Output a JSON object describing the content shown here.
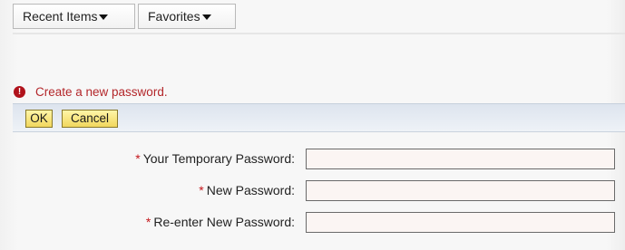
{
  "nav": {
    "recent_items_label": "Recent Items",
    "favorites_label": "Favorites"
  },
  "message": {
    "icon": "error-icon",
    "icon_glyph": "!",
    "text": "Create a new password."
  },
  "actions": {
    "ok_label": "OK",
    "cancel_label": "Cancel"
  },
  "form": {
    "required_marker": "*",
    "temporary_password_label": "Your Temporary Password:",
    "temporary_password_value": "",
    "new_password_label": "New Password:",
    "new_password_value": "",
    "reenter_password_label": "Re-enter New Password:",
    "reenter_password_value": ""
  },
  "colors": {
    "error_red": "#b3262a",
    "button_yellow": "#f1d75e",
    "action_bar_blue": "#dde4ee"
  }
}
